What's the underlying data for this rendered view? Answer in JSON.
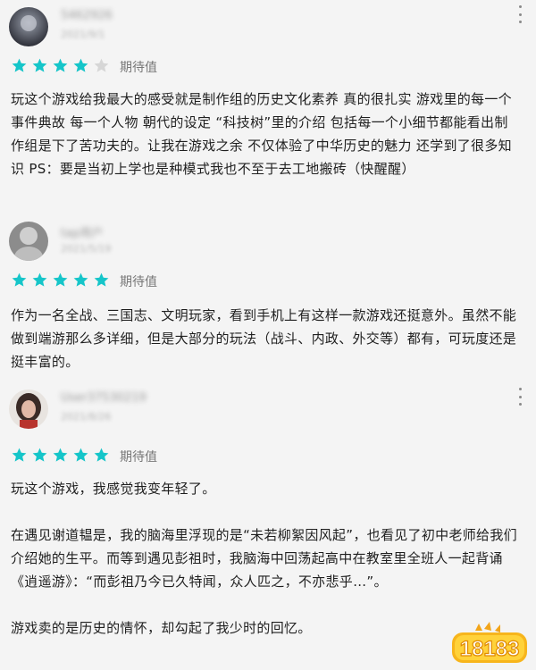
{
  "reviews": [
    {
      "username": "5462926",
      "date": "2021/9/1",
      "rating": 4,
      "rating_max": 5,
      "rating_label": "期待值",
      "paragraphs": [
        "玩这个游戏给我最大的感受就是制作组的历史文化素养 真的很扎实 游戏里的每一个事件典故 每一个人物 朝代的设定 “科技树”里的介绍 包括每一个小细节都能看出制作组是下了苦功夫的。让我在游戏之余 不仅体验了中华历史的魅力 还学到了很多知识 PS：要是当初上学也是种模式我也不至于去工地搬砖（快醒醒）"
      ]
    },
    {
      "username": "tap用户",
      "date": "2021/5/19",
      "rating": 5,
      "rating_max": 5,
      "rating_label": "期待值",
      "paragraphs": [
        "作为一名全战、三国志、文明玩家，看到手机上有这样一款游戏还挺意外。虽然不能做到端游那么多详细，但是大部分的玩法（战斗、内政、外交等）都有，可玩度还是挺丰富的。"
      ]
    },
    {
      "username": "User37530219",
      "date": "2021/8/26",
      "rating": 5,
      "rating_max": 5,
      "rating_label": "期待值",
      "paragraphs": [
        "玩这个游戏，我感觉我变年轻了。",
        "在遇见谢道韫是，我的脑海里浮现的是“未若柳絮因风起”，也看见了初中老师给我们介绍她的生平。而等到遇见彭祖时，我脑海中回荡起高中在教室里全班人一起背诵《逍遥游》：“而彭祖乃今已久特闻，众人匹之，不亦悲乎…”。",
        "游戏卖的是历史的情怀，却勾起了我少时的回忆。"
      ]
    }
  ],
  "colors": {
    "star_filled": "#15c5c9",
    "star_empty": "#d6d6d6",
    "background": "#f4f4f4"
  },
  "watermark": {
    "text": "18183"
  }
}
